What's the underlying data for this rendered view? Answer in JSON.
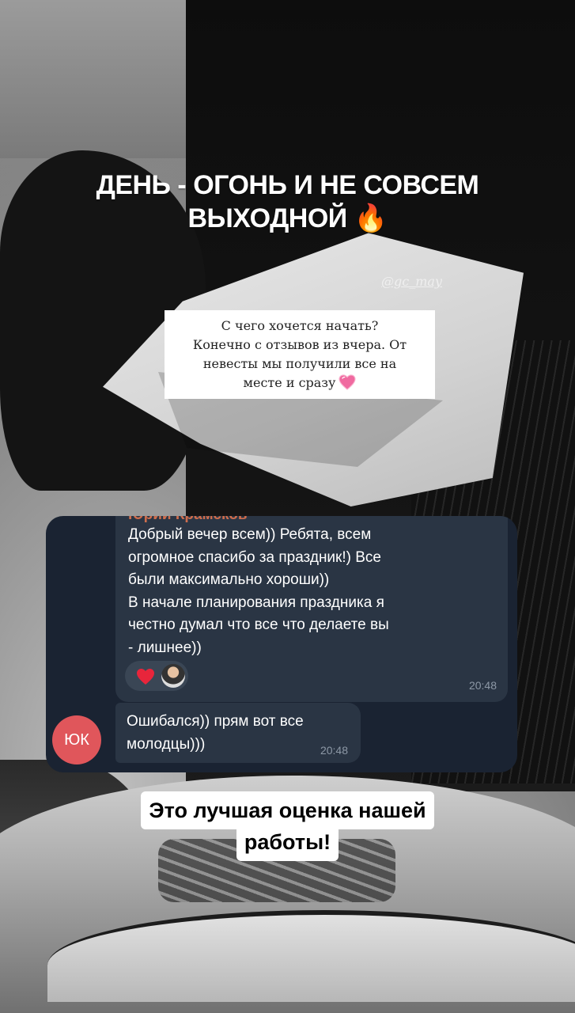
{
  "story": {
    "headline_line1": "ДЕНЬ - ОГОНЬ И НЕ СОВСЕМ",
    "headline_line2": "ВЫХОДНОЙ",
    "headline_emoji": "🔥",
    "handle": "@gc_may",
    "note_lines": [
      "С чего хочется начать?",
      "Конечно с отзывов из вчера. От",
      "невесты мы получили все на",
      "месте и сразу"
    ],
    "note_emoji": "pink-heart-icon",
    "caption_line1": "Это лучшая оценка нашей",
    "caption_line2": "работы!"
  },
  "chat": {
    "sender_name": "Юрий Крамсков",
    "message1_lines": [
      "Добрый вечер всем)) Ребята, всем",
      "огромное спасибо за праздник!) Все",
      "были максимально хороши))",
      "В начале планирования праздника я",
      "честно думал что все что делаете вы",
      "- лишнее))"
    ],
    "message1_time": "20:48",
    "reactions": [
      "red-heart-icon",
      "user-avatar-icon"
    ],
    "message2_lines": [
      "Ошибался)) прям вот все",
      "молодцы)))"
    ],
    "message2_time": "20:48",
    "avatar_initials": "ЮК",
    "avatar_color": "#e0565b",
    "bubble_color": "#2a3544",
    "chat_bg_color": "#1a2332"
  }
}
